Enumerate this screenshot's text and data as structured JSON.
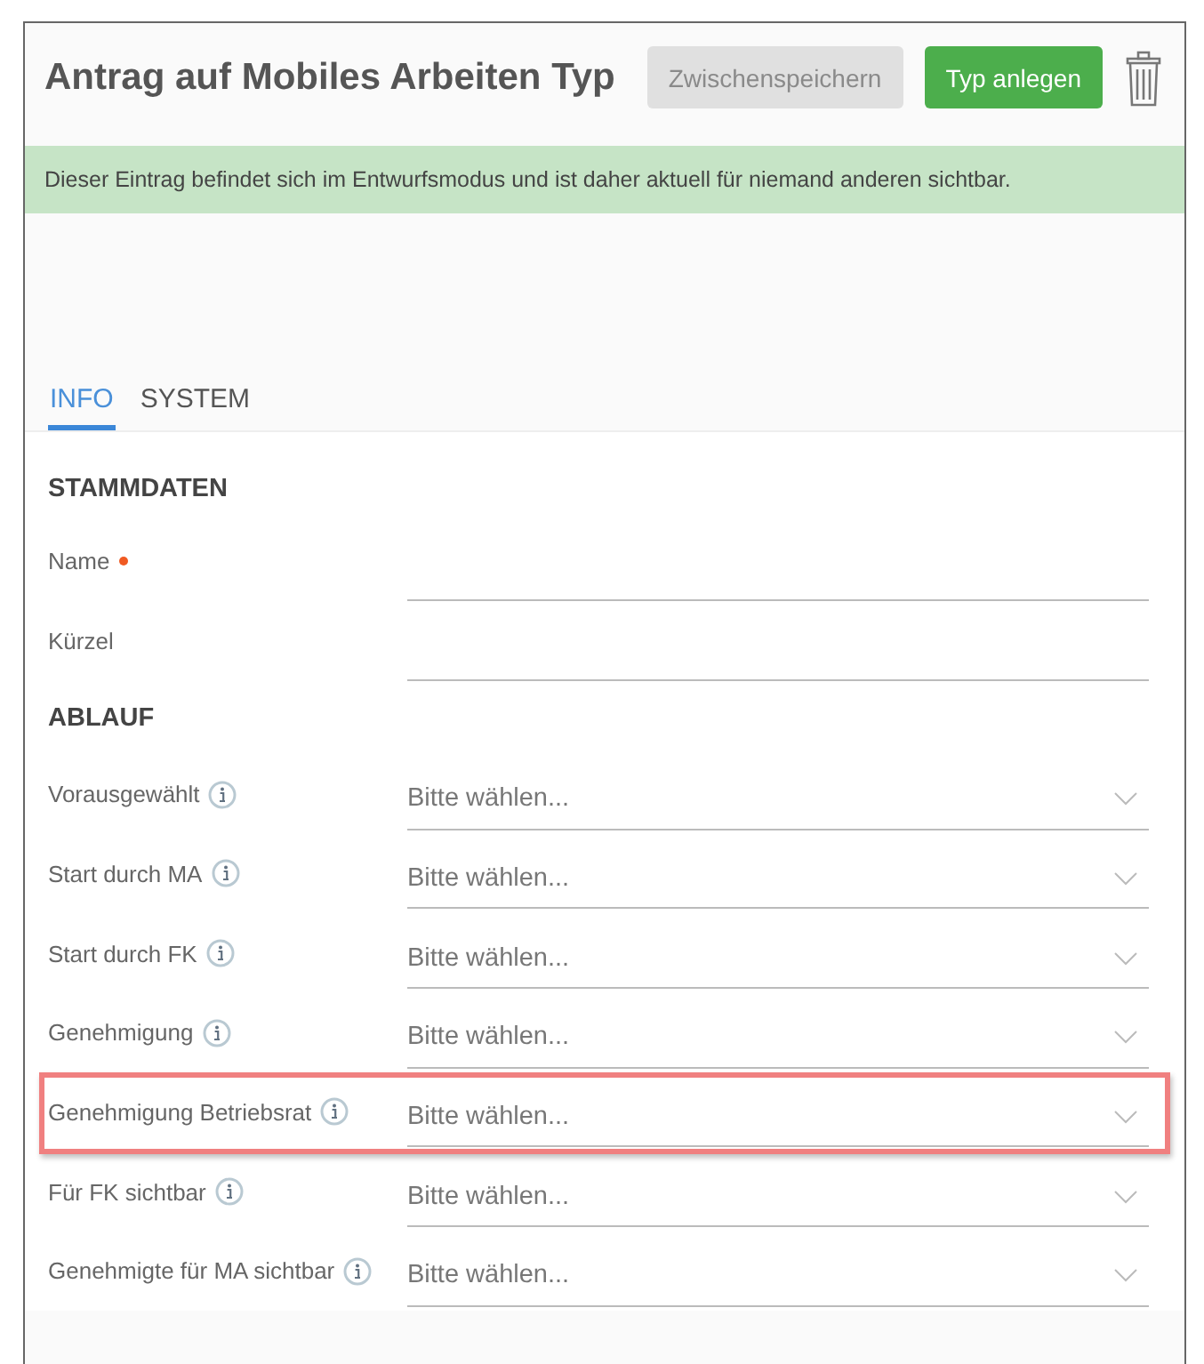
{
  "header": {
    "title": "Antrag auf Mobiles Arbeiten Typ",
    "buttons": [
      {
        "label": "Zwischenspeichern",
        "disabled": true
      },
      {
        "label": "Typ anlegen",
        "disabled": false
      }
    ]
  },
  "banner": "Dieser Eintrag befindet sich im Entwurfsmodus und ist daher aktuell für niemand anderen sichtbar.",
  "tabs": [
    {
      "label": "INFO",
      "selected": true
    },
    {
      "label": "SYSTEM",
      "selected": false
    }
  ],
  "sections": [
    {
      "title": "STAMMDATEN",
      "fields": [
        {
          "kind": "text",
          "label": "Name",
          "required": true,
          "info": false,
          "highlighted": false
        },
        {
          "kind": "text",
          "label": "Kürzel",
          "required": false,
          "info": false,
          "highlighted": false
        }
      ]
    },
    {
      "title": "ABLAUF",
      "fields": [
        {
          "kind": "select",
          "label": "Vorausgewählt",
          "required": false,
          "info": true,
          "highlighted": false,
          "placeholder": "Bitte wählen..."
        },
        {
          "kind": "select",
          "label": "Start durch MA",
          "required": false,
          "info": true,
          "highlighted": false,
          "placeholder": "Bitte wählen..."
        },
        {
          "kind": "select",
          "label": "Start durch FK",
          "required": false,
          "info": true,
          "highlighted": false,
          "placeholder": "Bitte wählen..."
        },
        {
          "kind": "select",
          "label": "Genehmigung",
          "required": false,
          "info": true,
          "highlighted": false,
          "placeholder": "Bitte wählen..."
        },
        {
          "kind": "select",
          "label": "Genehmigung Betriebsrat",
          "required": false,
          "info": true,
          "highlighted": true,
          "placeholder": "Bitte wählen..."
        },
        {
          "kind": "select",
          "label": "Für FK sichtbar",
          "required": false,
          "info": true,
          "highlighted": false,
          "placeholder": "Bitte wählen..."
        },
        {
          "kind": "select",
          "label": "Genehmigte für MA sichtbar",
          "required": false,
          "info": true,
          "highlighted": false,
          "placeholder": "Bitte wählen..."
        }
      ]
    }
  ]
}
